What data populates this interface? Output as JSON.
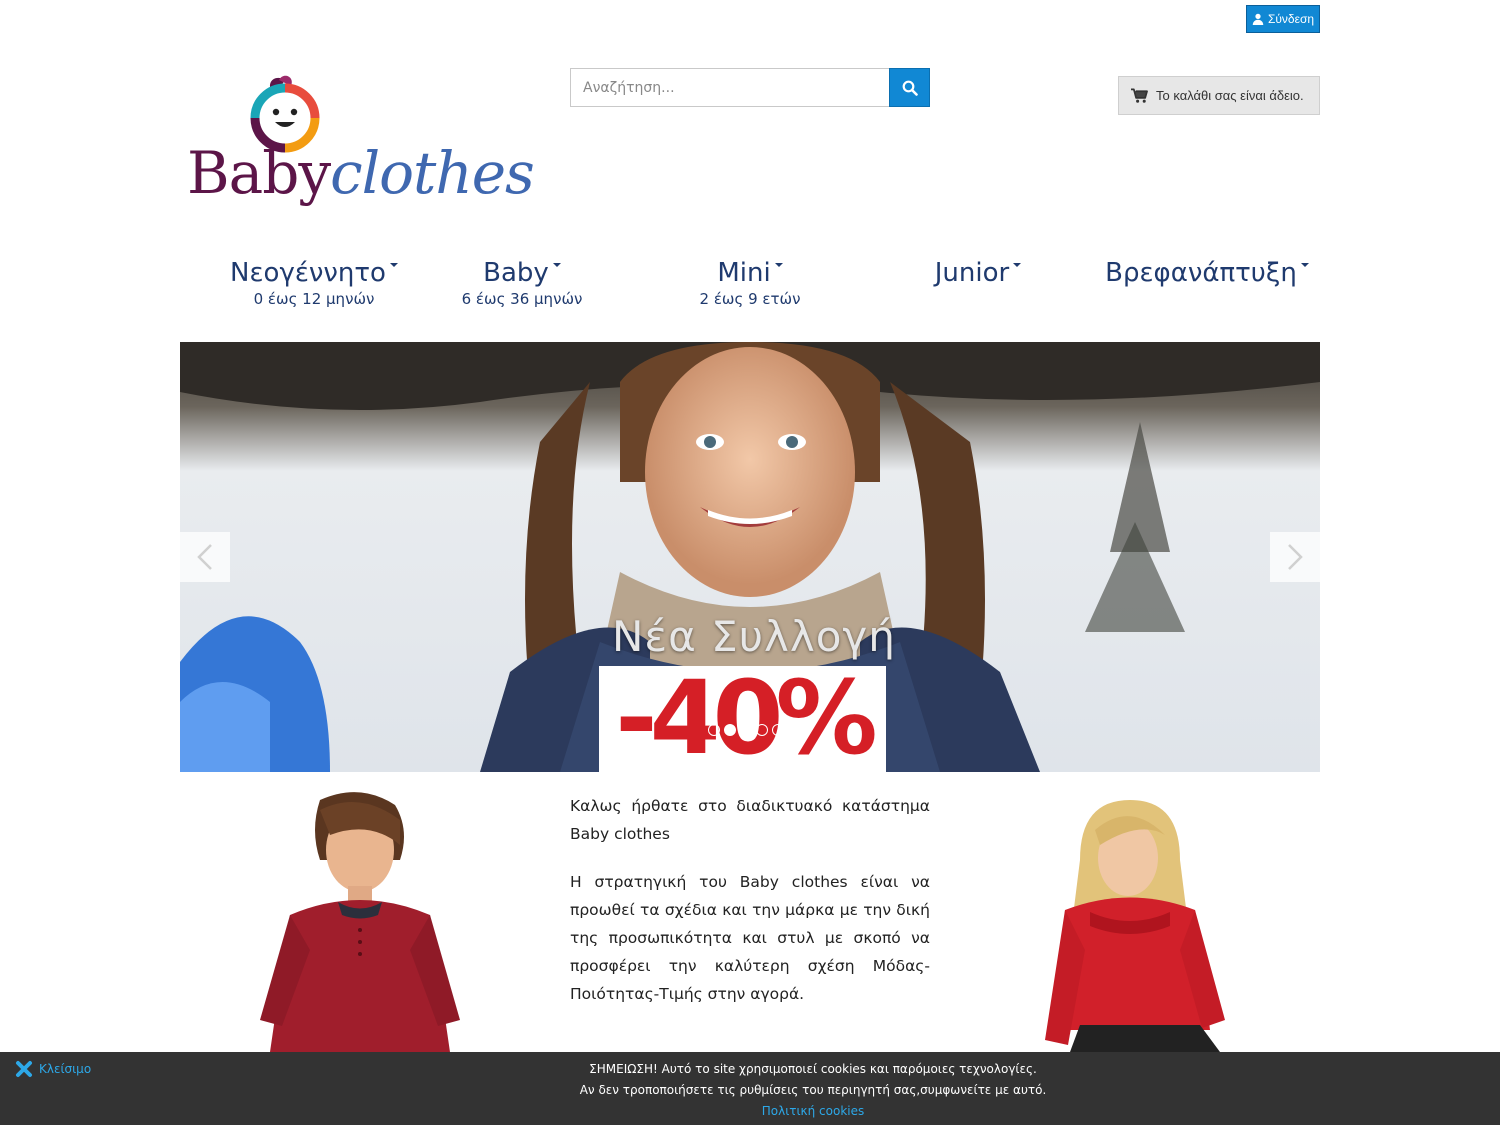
{
  "header": {
    "login_label": "Σύνδεση",
    "search_placeholder": "Αναζήτηση...",
    "cart_label": "Το καλάθι σας είναι άδειο."
  },
  "logo": {
    "part1": "Baby",
    "part2": "clothes"
  },
  "nav": [
    {
      "title": "Νεογέννητο",
      "sub": "0 έως 12 μηνών"
    },
    {
      "title": "Baby",
      "sub": "6 έως 36 μηνών"
    },
    {
      "title": "Mini",
      "sub": "2 έως 9 ετών"
    },
    {
      "title": "Junior",
      "sub": ""
    },
    {
      "title": "Βρεφανάπτυξη",
      "sub": ""
    }
  ],
  "slider": {
    "caption": "Νέα Συλλογή",
    "discount": "-40%",
    "active_index": 1,
    "count": 5
  },
  "welcome": {
    "heading": "Καλως ήρθατε στο διαδικτυακό κατάστημα Baby clothes",
    "body": "Η στρατηγική του Baby clothes είναι να προωθεί τα σχέδια και την μάρκα με την δική της προσωπικότητα και στυλ με σκοπό να προσφέρει την καλύτερη σχέση Μόδας- Ποιότητας-Τιμής στην αγορά."
  },
  "cookie": {
    "close_label": "Κλείσιμο",
    "line1": "ΣΗΜΕΙΩΣΗ! Αυτό το site χρησιμοποιεί cookies και παρόμοιες τεχνολογίες.",
    "line2": "Αν δεν τροποποιήσετε τις ρυθμίσεις του περιηγητή σας,συμφωνείτε με αυτό.",
    "policy_link": "Πολιτική cookies"
  },
  "colors": {
    "accent": "#1188d4",
    "nav_text": "#1f3a6e",
    "logo_baby": "#5c1548",
    "logo_clothes": "#3f68b0",
    "discount": "#d51f26",
    "cookie_bg": "#333333"
  },
  "icons": {
    "login": "user-icon",
    "search": "search-icon",
    "cart": "cart-icon",
    "close": "close-icon",
    "prev": "chevron-left-icon",
    "next": "chevron-right-icon"
  }
}
